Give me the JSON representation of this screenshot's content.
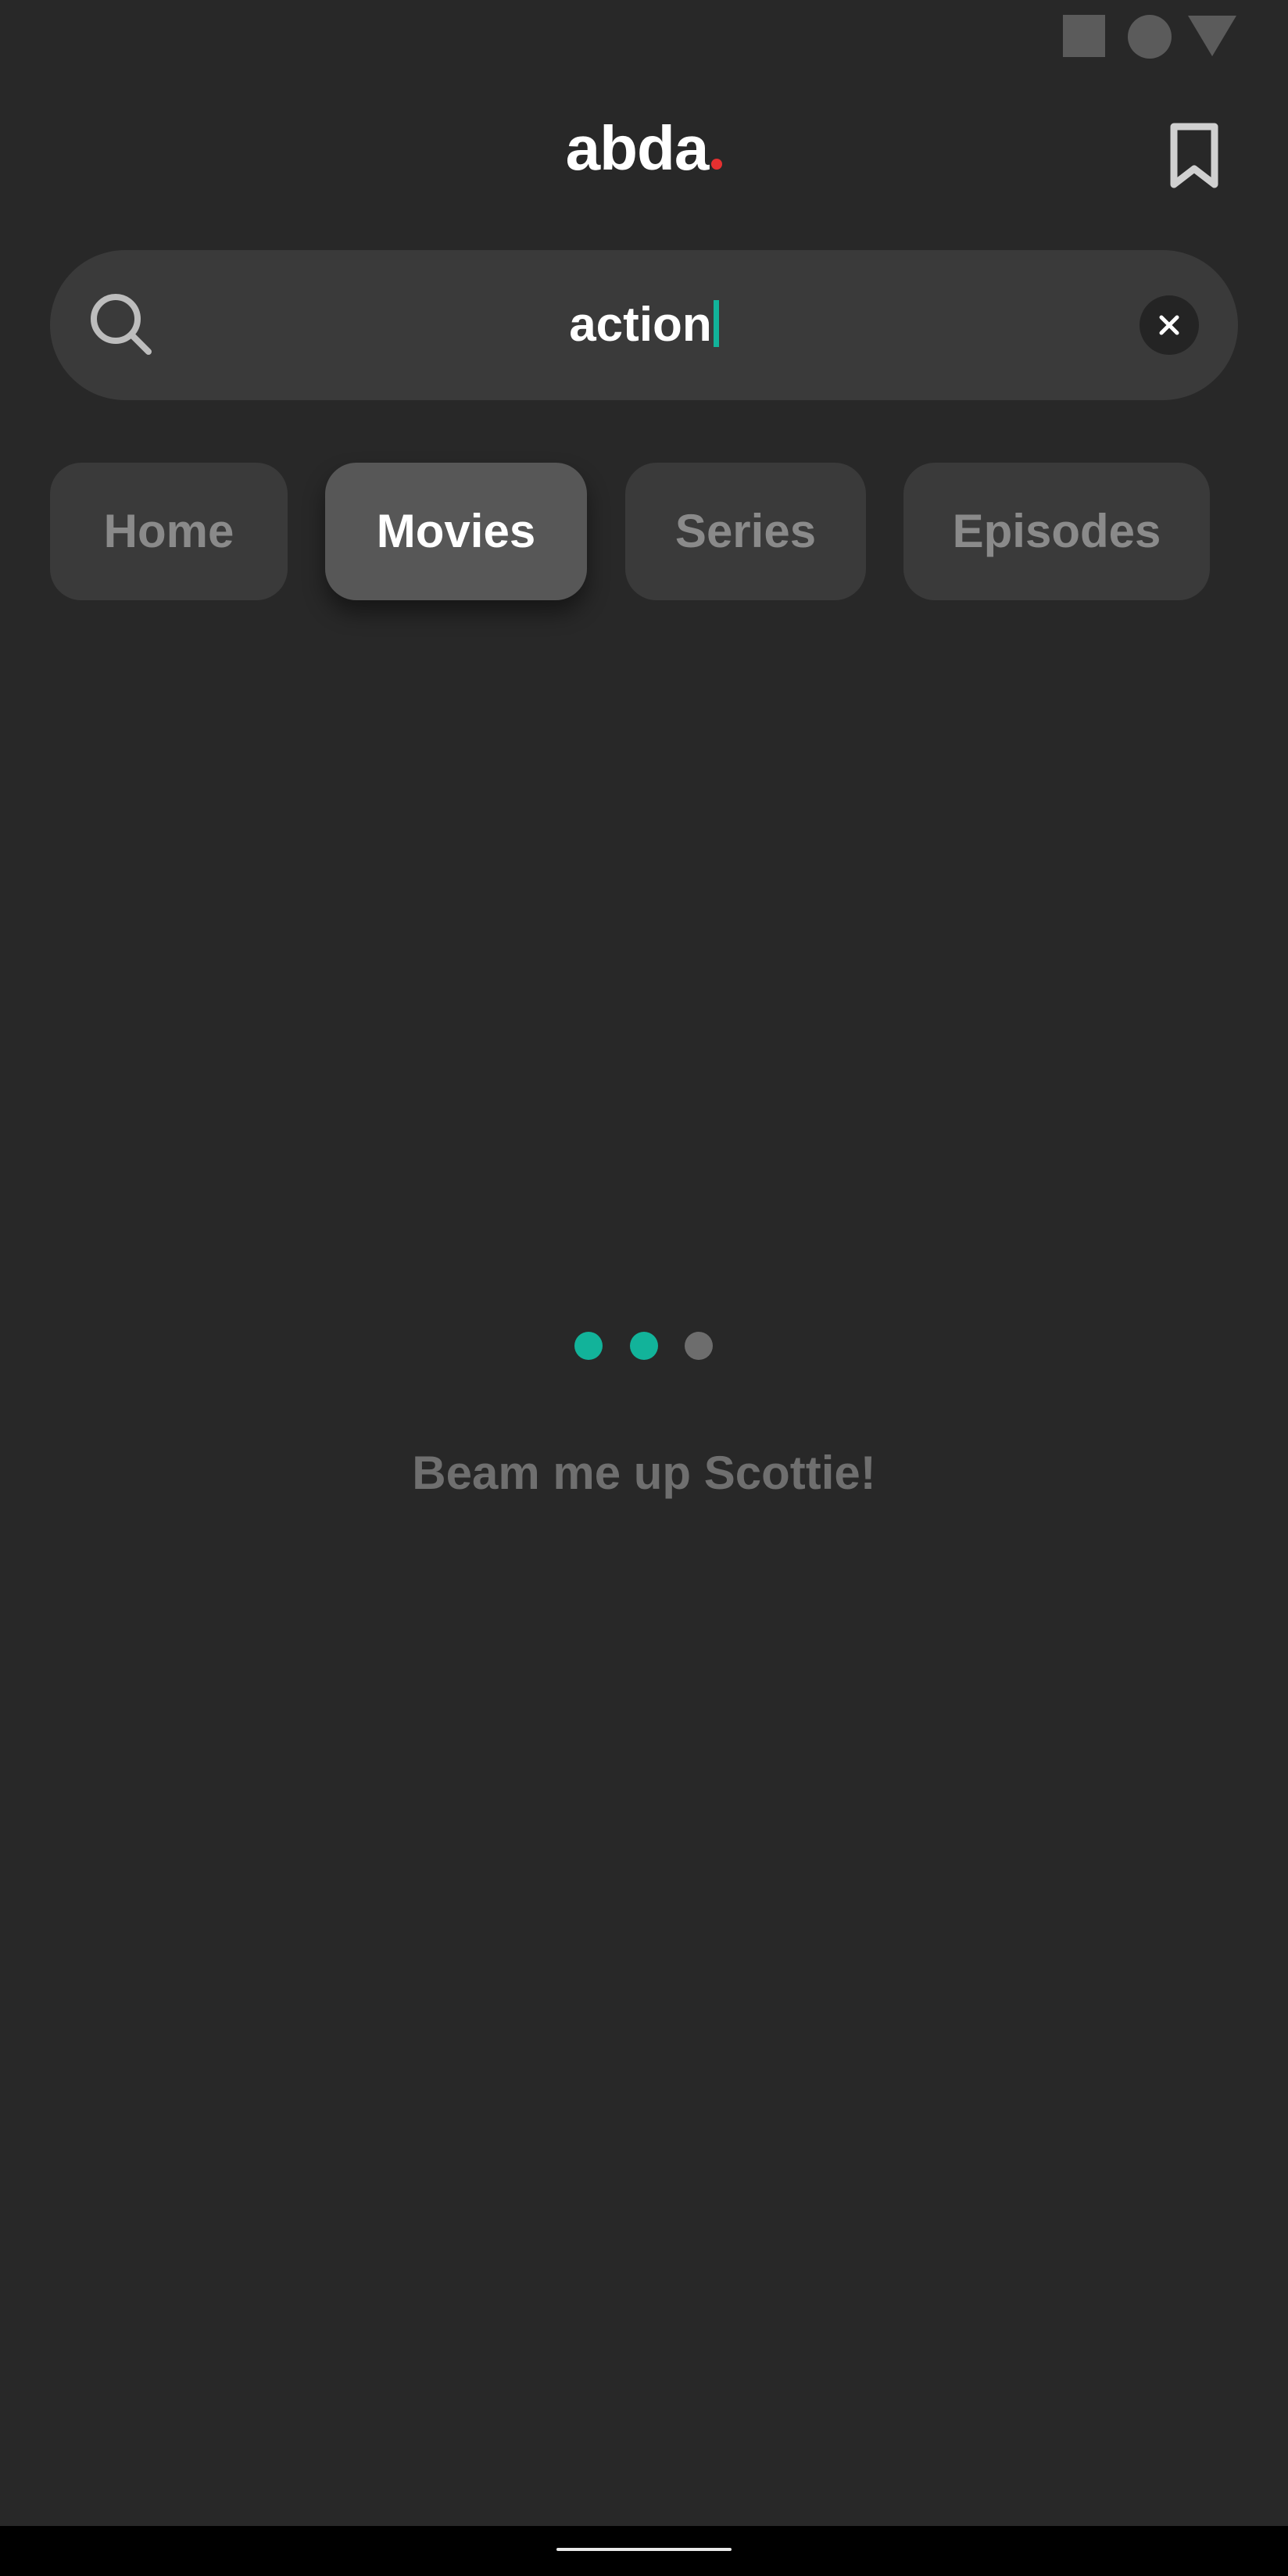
{
  "app": {
    "logo_text": "abda",
    "logo_dot_color": "#e53030"
  },
  "search": {
    "value": "action",
    "caret_color": "#12b39a"
  },
  "tabs": [
    {
      "label": "Home",
      "active": false
    },
    {
      "label": "Movies",
      "active": true
    },
    {
      "label": "Series",
      "active": false
    },
    {
      "label": "Episodes",
      "active": false
    }
  ],
  "loader": {
    "dots": [
      {
        "color": "#12b39a"
      },
      {
        "color": "#12b39a"
      },
      {
        "color": "#6d6d6d"
      }
    ],
    "message": "Beam me up Scottie!"
  },
  "icons": {
    "bookmark": "bookmark-icon",
    "search": "search-icon",
    "clear": "close-icon"
  }
}
